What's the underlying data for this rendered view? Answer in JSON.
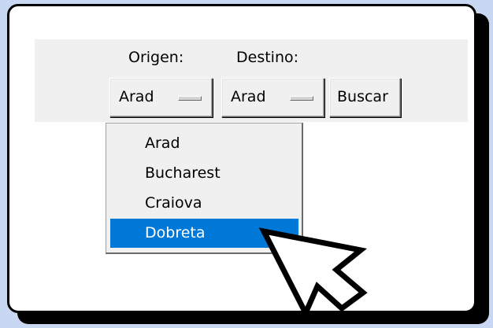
{
  "labels": {
    "origen": "Origen:",
    "destino": "Destino:"
  },
  "origen_menu": {
    "selected": "Arad",
    "options": [
      "Arad",
      "Bucharest",
      "Craiova",
      "Dobreta"
    ],
    "highlighted": "Dobreta"
  },
  "destino_menu": {
    "selected": "Arad"
  },
  "search_button": {
    "label": "Buscar"
  },
  "colors": {
    "background": "#c9d8f2",
    "selection": "#0078d7",
    "panel": "#f0f0f0"
  },
  "icons": {
    "cursor": "mouse-pointer-icon"
  }
}
